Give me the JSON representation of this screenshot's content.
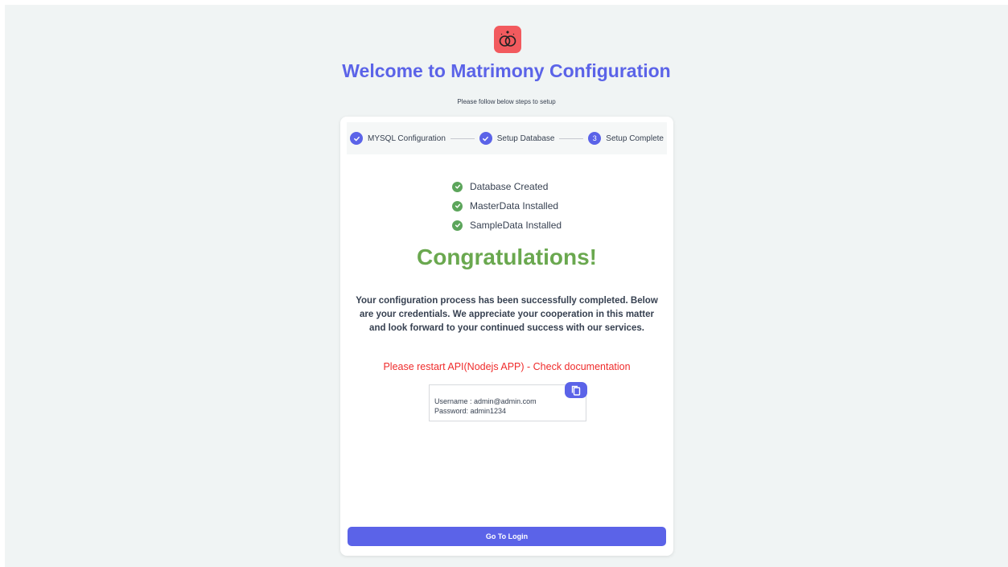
{
  "header": {
    "title": "Welcome to Matrimony Configuration",
    "subtitle": "Please follow below steps to setup",
    "logo_icon": "rings-icon",
    "logo_color": "#f25a5e"
  },
  "steps": [
    {
      "label": "MYSQL Configuration",
      "status": "done"
    },
    {
      "label": "Setup Database",
      "status": "done"
    },
    {
      "label": "Setup Complete",
      "number": "3",
      "status": "current"
    }
  ],
  "checks": [
    {
      "label": "Database Created"
    },
    {
      "label": "MasterData Installed"
    },
    {
      "label": "SampleData Installed"
    }
  ],
  "congrats": "Congratulations!",
  "message": "Your configuration process has been successfully completed. Below are your credentials. We appreciate your cooperation in this matter and look forward to your continued success with our services.",
  "restart_notice": "Please restart API(Nodejs APP) - Check documentation",
  "credentials": {
    "username_line": "Username : admin@admin.com",
    "password_line": "Password: admin1234"
  },
  "actions": {
    "login_label": "Go To Login"
  },
  "colors": {
    "accent": "#5b63e8",
    "success": "#6aa84f",
    "error": "#ef2b2b"
  }
}
